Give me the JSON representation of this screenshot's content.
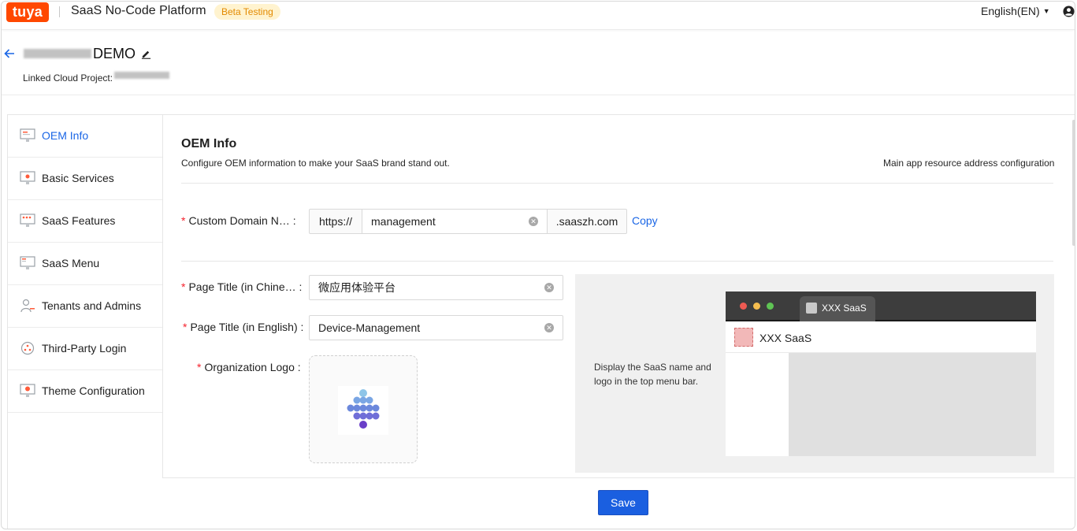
{
  "app": {
    "logo_text": "tuya",
    "platform_name": "SaaS No-Code Platform",
    "badge": "Beta Testing",
    "language": "English(EN)"
  },
  "header": {
    "title_suffix": "DEMO",
    "linked_label": "Linked Cloud Project:"
  },
  "sidebar": {
    "items": [
      {
        "label": "OEM Info",
        "icon": "monitor-icon",
        "active": true
      },
      {
        "label": "Basic Services",
        "icon": "services-icon",
        "active": false
      },
      {
        "label": "SaaS Features",
        "icon": "features-icon",
        "active": false
      },
      {
        "label": "SaaS Menu",
        "icon": "menu-icon",
        "active": false
      },
      {
        "label": "Tenants and Admins",
        "icon": "user-icon",
        "active": false
      },
      {
        "label": "Third-Party Login",
        "icon": "share-icon",
        "active": false
      },
      {
        "label": "Theme Configuration",
        "icon": "theme-icon",
        "active": false
      }
    ]
  },
  "section": {
    "title": "OEM Info",
    "description": "Configure OEM information to make your SaaS brand stand out.",
    "right_link": "Main app resource address configuration"
  },
  "form": {
    "domain": {
      "label": "Custom Domain N… :",
      "prefix": "https://",
      "value": "management",
      "suffix": ".saaszh.com",
      "copy_label": "Copy"
    },
    "title_cn": {
      "label": "Page Title (in Chine… :",
      "value": "微应用体验平台"
    },
    "title_en": {
      "label": "Page Title (in English) :",
      "value": "Device-Management"
    },
    "logo": {
      "label": "Organization Logo :"
    }
  },
  "preview": {
    "description": "Display the SaaS name and logo in the top menu bar.",
    "tab_title": "XXX SaaS",
    "header_title": "XXX SaaS",
    "dot_colors": [
      "#ee5a52",
      "#f5bd4f",
      "#5fc454"
    ]
  },
  "footer": {
    "save_label": "Save"
  },
  "colors": {
    "brand": "#ff4800",
    "primary": "#1a5fe0",
    "link": "#1a66e6",
    "required": "#f5222d"
  }
}
